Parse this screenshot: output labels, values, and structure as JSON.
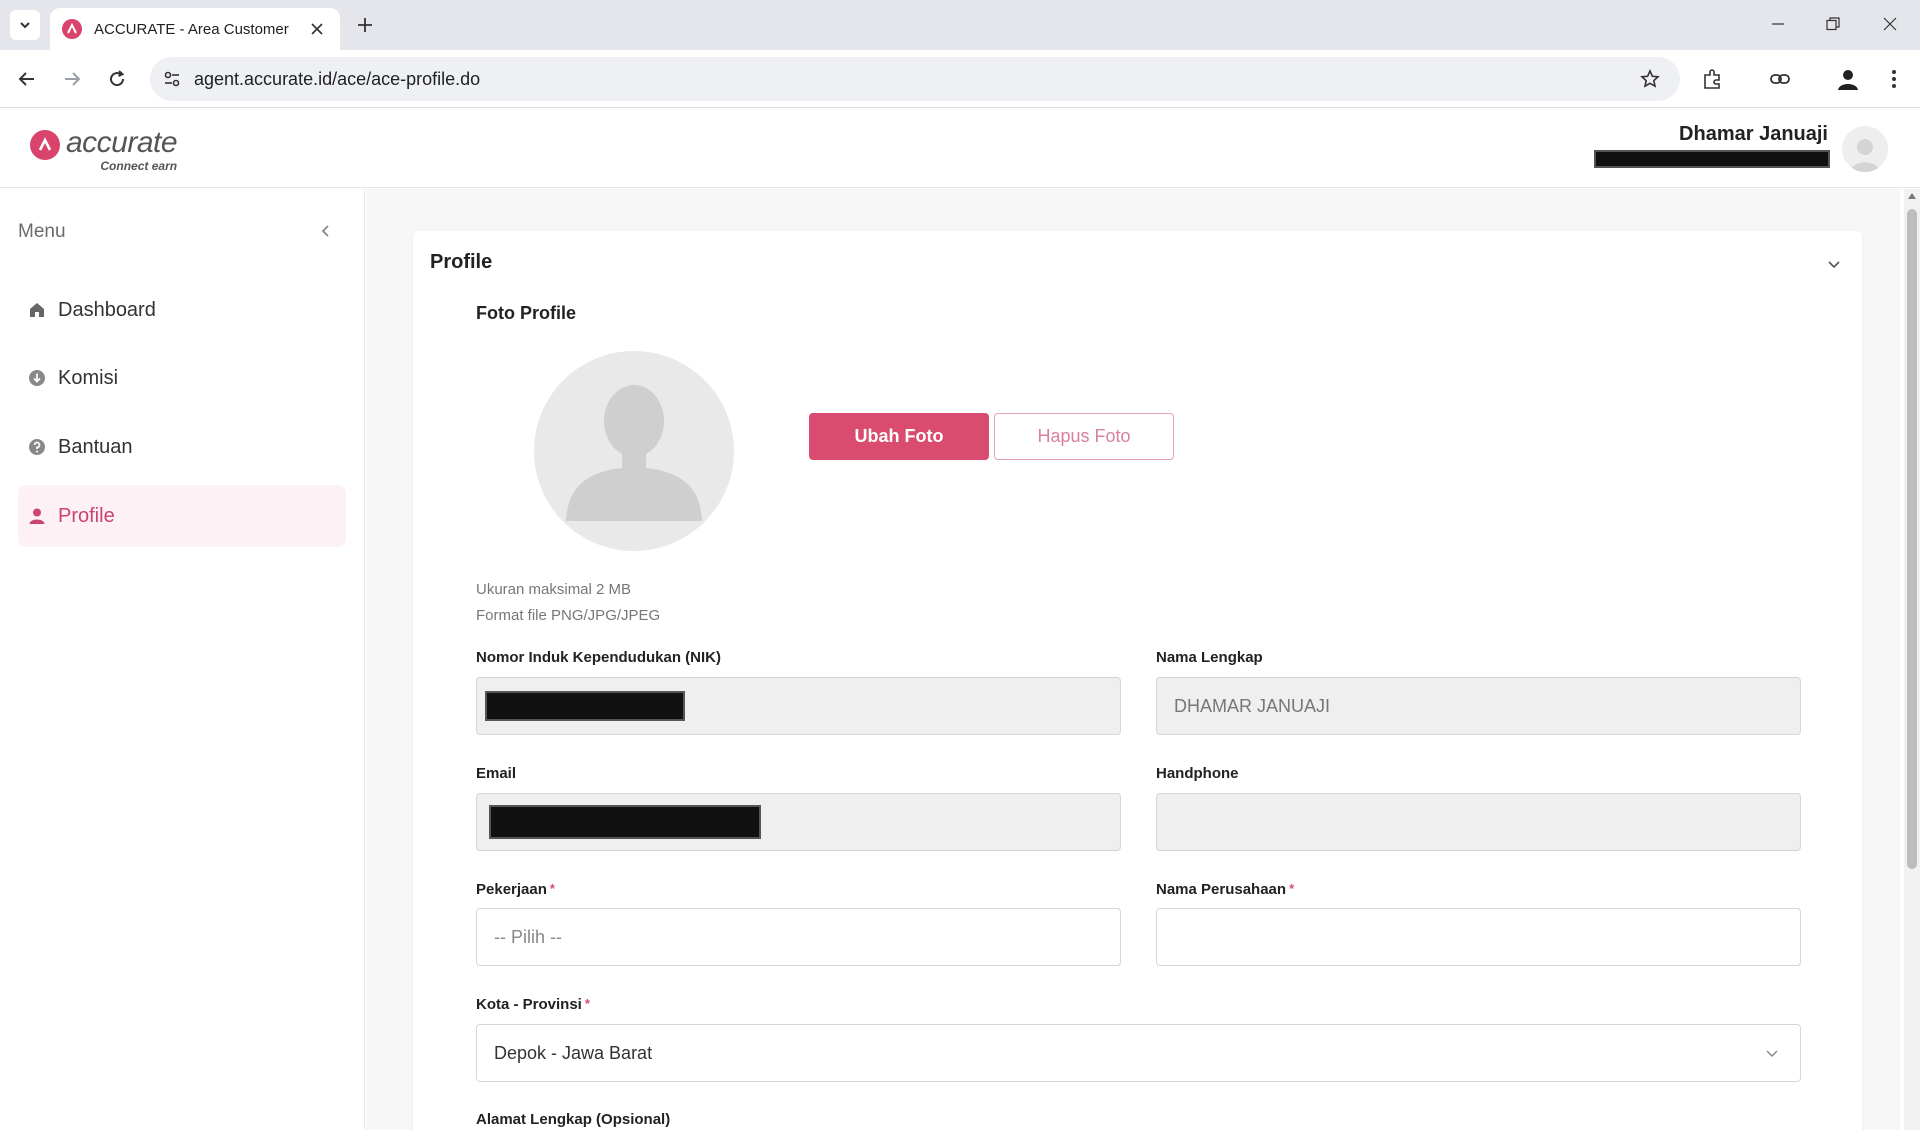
{
  "browser": {
    "tab_title": "ACCURATE - Area Customer",
    "url": "agent.accurate.id/ace/ace-profile.do"
  },
  "header": {
    "logo_word": "accurate",
    "logo_tagline": "Connect earn",
    "user_name": "Dhamar Januaji"
  },
  "sidebar": {
    "menu_label": "Menu",
    "items": [
      {
        "label": "Dashboard",
        "icon": "home-icon"
      },
      {
        "label": "Komisi",
        "icon": "download-circle-icon"
      },
      {
        "label": "Bantuan",
        "icon": "help-circle-icon"
      },
      {
        "label": "Profile",
        "icon": "user-icon",
        "active": true
      }
    ]
  },
  "profile": {
    "title": "Profile",
    "photo_section_title": "Foto Profile",
    "change_photo_label": "Ubah Foto",
    "delete_photo_label": "Hapus Foto",
    "hint_size": "Ukuran maksimal 2 MB",
    "hint_format": "Format file PNG/JPG/JPEG",
    "fields": {
      "nik_label": "Nomor Induk Kependudukan (NIK)",
      "full_name_label": "Nama Lengkap",
      "full_name_value": "DHAMAR JANUAJI",
      "email_label": "Email",
      "phone_label": "Handphone",
      "job_label": "Pekerjaan",
      "job_placeholder": "-- Pilih --",
      "company_label": "Nama Perusahaan",
      "city_label": "Kota - Provinsi",
      "city_value": "Depok - Jawa Barat",
      "address_label": "Alamat Lengkap (Opsional)",
      "required_mark": "*"
    }
  },
  "colors": {
    "accent": "#d94b6f",
    "active_bg": "#fdf1f5"
  }
}
